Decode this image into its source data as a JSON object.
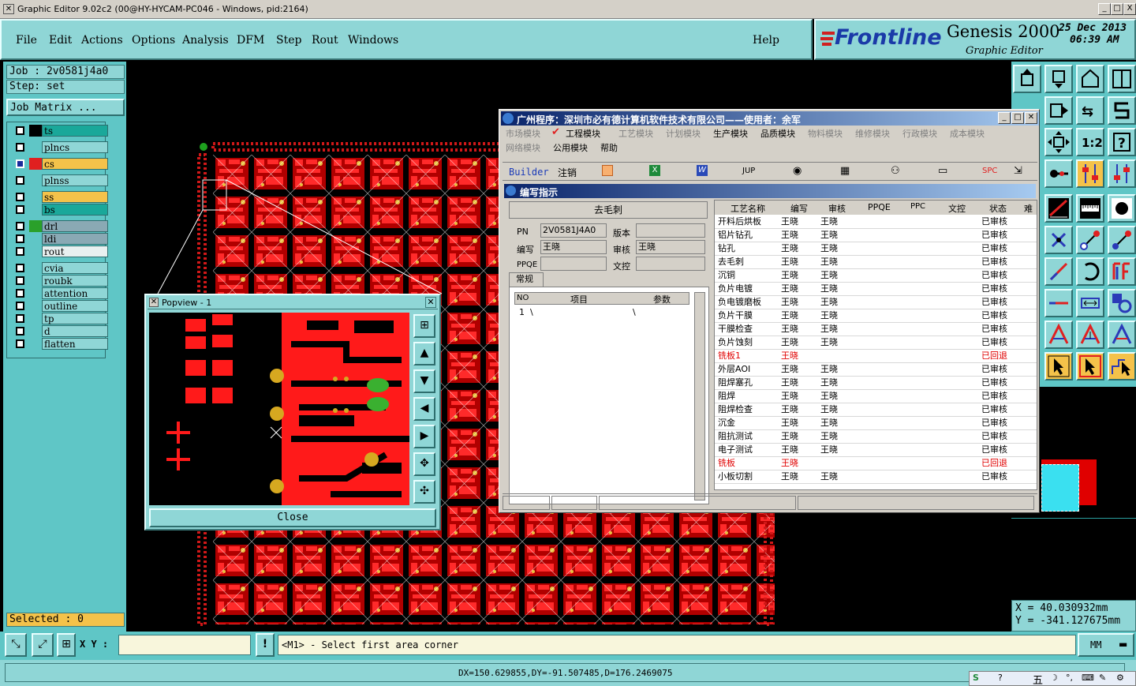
{
  "window": {
    "title": "Graphic Editor 9.02c2 (00@HY-HYCAM-PC046 - Windows, pid:2164)",
    "min": "_",
    "max": "□",
    "close": "X"
  },
  "menu": {
    "items": [
      "File",
      "Edit",
      "Actions",
      "Options",
      "Analysis",
      "DFM",
      "Step",
      "Rout",
      "Windows"
    ],
    "help": "Help"
  },
  "brand": {
    "logo": "Frontline",
    "product": "Genesis 2000",
    "subtitle": "Graphic Editor",
    "date": "25 Dec 2013",
    "time": "06:39 AM"
  },
  "left": {
    "job": "Job : 2v0581j4a0",
    "step": "Step: set",
    "job_matrix": "Job Matrix ...",
    "selected": "Selected : 0",
    "layers": [
      {
        "name": "ts",
        "color": "#1aa89a",
        "sw": "#000000"
      },
      {
        "name": "plncs",
        "color": "#8fd6d6",
        "sw": ""
      },
      {
        "name": "cs",
        "color": "#f4c24a",
        "sw": "#e02020"
      },
      {
        "name": "plnss",
        "color": "#8fd6d6",
        "sw": ""
      },
      {
        "name": "ss",
        "color": "#f4c24a",
        "sw": ""
      },
      {
        "name": "bs",
        "color": "#1aa89a",
        "sw": ""
      },
      {
        "name": "drl",
        "color": "#8aa9b4",
        "sw": "#2aa02a"
      },
      {
        "name": "ldi",
        "color": "#8aa9b4",
        "sw": ""
      },
      {
        "name": "rout",
        "color": "#e8f0f0",
        "sw": ""
      },
      {
        "name": "cvia",
        "color": "#8fd6d6",
        "sw": ""
      },
      {
        "name": "roubk",
        "color": "#8fd6d6",
        "sw": ""
      },
      {
        "name": "attention",
        "color": "#8fd6d6",
        "sw": ""
      },
      {
        "name": "outline",
        "color": "#8fd6d6",
        "sw": ""
      },
      {
        "name": "tp",
        "color": "#8fd6d6",
        "sw": ""
      },
      {
        "name": "d",
        "color": "#8fd6d6",
        "sw": ""
      },
      {
        "name": "flatten",
        "color": "#8fd6d6",
        "sw": ""
      }
    ]
  },
  "popview": {
    "title": "Popview - 1",
    "close_btn": "Close"
  },
  "mes": {
    "title": "广州程序：深圳市必有德计算机软件技术有限公司——使用者：余军",
    "menu1": [
      "市场模块",
      "工程模块",
      "工艺模块",
      "计划模块",
      "生产模块",
      "品质模块",
      "物料模块",
      "维修模块",
      "行政模块",
      "成本模块"
    ],
    "menu2": [
      "网络模块",
      "公用模块",
      "帮助"
    ],
    "toolbar": [
      "Builder",
      "注销",
      "",
      "",
      "",
      "JUP",
      "",
      "",
      "",
      "",
      "SPC",
      ""
    ],
    "panel_title": "编写指示",
    "section": "去毛刺",
    "pn_label": "PN",
    "pn_value": "2V0581J4A0",
    "version_label": "版本",
    "writer_label": "编写",
    "writer_value": "王晓",
    "review_label": "审核",
    "review_value": "王晓",
    "ppqe_label": "PPQE",
    "doc_label": "文控",
    "tab": "常规",
    "small_headers": [
      "NO",
      "项目",
      "参数"
    ],
    "small_row": [
      "1",
      "\\",
      "\\"
    ],
    "headers": [
      "工艺名称",
      "编写",
      "审核",
      "PPQE",
      "PPC",
      "文控",
      "状态",
      "难"
    ],
    "rows": [
      [
        "开料后烘板",
        "王晓",
        "王晓",
        "已审核"
      ],
      [
        "铝片钻孔",
        "王晓",
        "王晓",
        "已审核"
      ],
      [
        "钻孔",
        "王晓",
        "王晓",
        "已审核"
      ],
      [
        "去毛刺",
        "王晓",
        "王晓",
        "已审核"
      ],
      [
        "沉铜",
        "王晓",
        "王晓",
        "已审核"
      ],
      [
        "负片电镀",
        "王晓",
        "王晓",
        "已审核"
      ],
      [
        "负电镀磨板",
        "王晓",
        "王晓",
        "已审核"
      ],
      [
        "负片干膜",
        "王晓",
        "王晓",
        "已审核"
      ],
      [
        "干膜检查",
        "王晓",
        "王晓",
        "已审核"
      ],
      [
        "负片蚀刻",
        "王晓",
        "王晓",
        "已审核"
      ],
      [
        "铣板1",
        "王晓",
        "",
        "已回退"
      ],
      [
        "外层AOI",
        "王晓",
        "王晓",
        "已审核"
      ],
      [
        "阻焊塞孔",
        "王晓",
        "王晓",
        "已审核"
      ],
      [
        "阻焊",
        "王晓",
        "王晓",
        "已审核"
      ],
      [
        "阻焊检查",
        "王晓",
        "王晓",
        "已审核"
      ],
      [
        "沉金",
        "王晓",
        "王晓",
        "已审核"
      ],
      [
        "阻抗测试",
        "王晓",
        "王晓",
        "已审核"
      ],
      [
        "电子测试",
        "王晓",
        "王晓",
        "已审核"
      ],
      [
        "铣板",
        "王晓",
        "",
        "已回退"
      ],
      [
        "小板切割",
        "王晓",
        "王晓",
        "已审核"
      ]
    ],
    "highlight_color": "#e00000"
  },
  "coords": {
    "x": "X = 40.030932mm",
    "y": "Y = -341.127675mm"
  },
  "bottom": {
    "xy_label": "X Y :",
    "xy_input": "",
    "prompt": "<M1> - Select first area corner",
    "units": "MM"
  },
  "status": {
    "measure": "DX=150.629855,DY=-91.507485,D=176.2469075"
  },
  "tray": [
    "S",
    "?",
    "五",
    "☽",
    "°,",
    "⌨",
    "✎",
    "⚙"
  ]
}
